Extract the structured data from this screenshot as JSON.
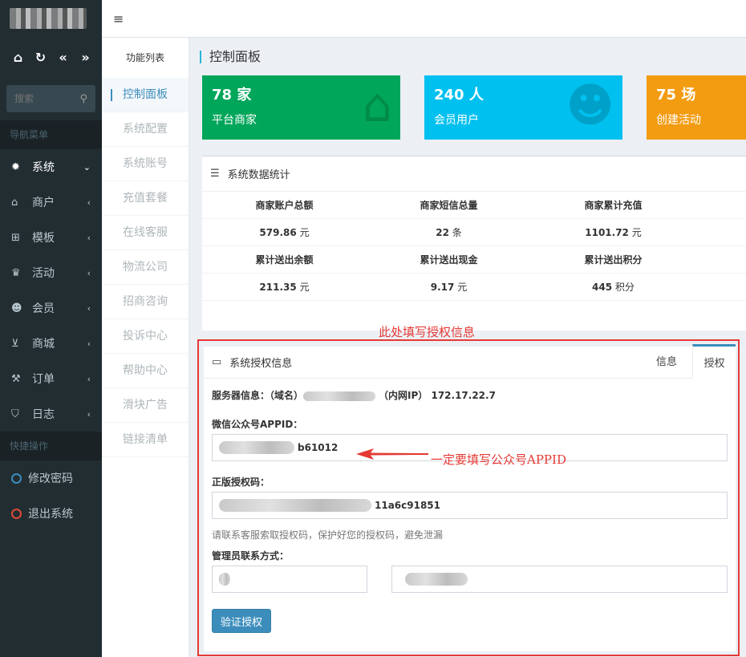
{
  "sidebar": {
    "search_placeholder": "搜索",
    "nav_header": "导航菜单",
    "items": [
      {
        "label": "系统",
        "icon": "gear-icon",
        "active": true
      },
      {
        "label": "商户",
        "icon": "home-icon"
      },
      {
        "label": "模板",
        "icon": "sitemap-icon"
      },
      {
        "label": "活动",
        "icon": "trophy-icon"
      },
      {
        "label": "会员",
        "icon": "users-icon"
      },
      {
        "label": "商城",
        "icon": "cart-icon"
      },
      {
        "label": "订单",
        "icon": "gavel-icon"
      },
      {
        "label": "日志",
        "icon": "shield-icon"
      }
    ],
    "quick_header": "快捷操作",
    "quick_items": [
      {
        "label": "修改密码",
        "color": "#3c8dbc"
      },
      {
        "label": "退出系统",
        "color": "#dd4b39"
      }
    ]
  },
  "funclist": {
    "header": "功能列表",
    "items": [
      "控制面板",
      "系统配置",
      "系统账号",
      "充值套餐",
      "在线客服",
      "物流公司",
      "招商咨询",
      "投诉中心",
      "帮助中心",
      "滑块广告",
      "链接清单"
    ]
  },
  "page": {
    "title": "控制面板"
  },
  "tiles": [
    {
      "value": "78 家",
      "caption": "平台商家",
      "color": "#00a65a",
      "icon": "home-icon"
    },
    {
      "value": "240 人",
      "caption": "会员用户",
      "color": "#00c0ef",
      "icon": "users-icon"
    },
    {
      "value": "75 场",
      "caption": "创建活动",
      "color": "#f39c12",
      "icon": "trophy-icon"
    }
  ],
  "stats": {
    "title": "系统数据统计",
    "row1_heads": [
      "商家账户总额",
      "商家短信总量",
      "商家累计充值"
    ],
    "row1_values": [
      {
        "n": "579.86",
        "u": "元"
      },
      {
        "n": "22",
        "u": "条"
      },
      {
        "n": "1101.72",
        "u": "元"
      }
    ],
    "row2_heads": [
      "累计送出余额",
      "累计送出现金",
      "累计送出积分"
    ],
    "row2_values": [
      {
        "n": "211.35",
        "u": "元"
      },
      {
        "n": "9.17",
        "u": "元"
      },
      {
        "n": "445",
        "u": "积分"
      }
    ]
  },
  "annotations": {
    "top": "此处填写授权信息",
    "appid": "一定要填写公众号APPID"
  },
  "auth": {
    "title": "系统授权信息",
    "tab_info": "信息",
    "tab_auth": "授权",
    "server_label": "服务器信息：（域名）",
    "server_mid": "（内网IP）",
    "server_ip": "172.17.22.7",
    "appid_label": "微信公众号APPID：",
    "appid_value": "b61012",
    "code_label": "正版授权码：",
    "code_value": "11a6c91851",
    "hint": "请联系客服索取授权码，保护好您的授权码，避免泄漏",
    "contact_label": "管理员联系方式：",
    "verify_button": "验证授权"
  }
}
